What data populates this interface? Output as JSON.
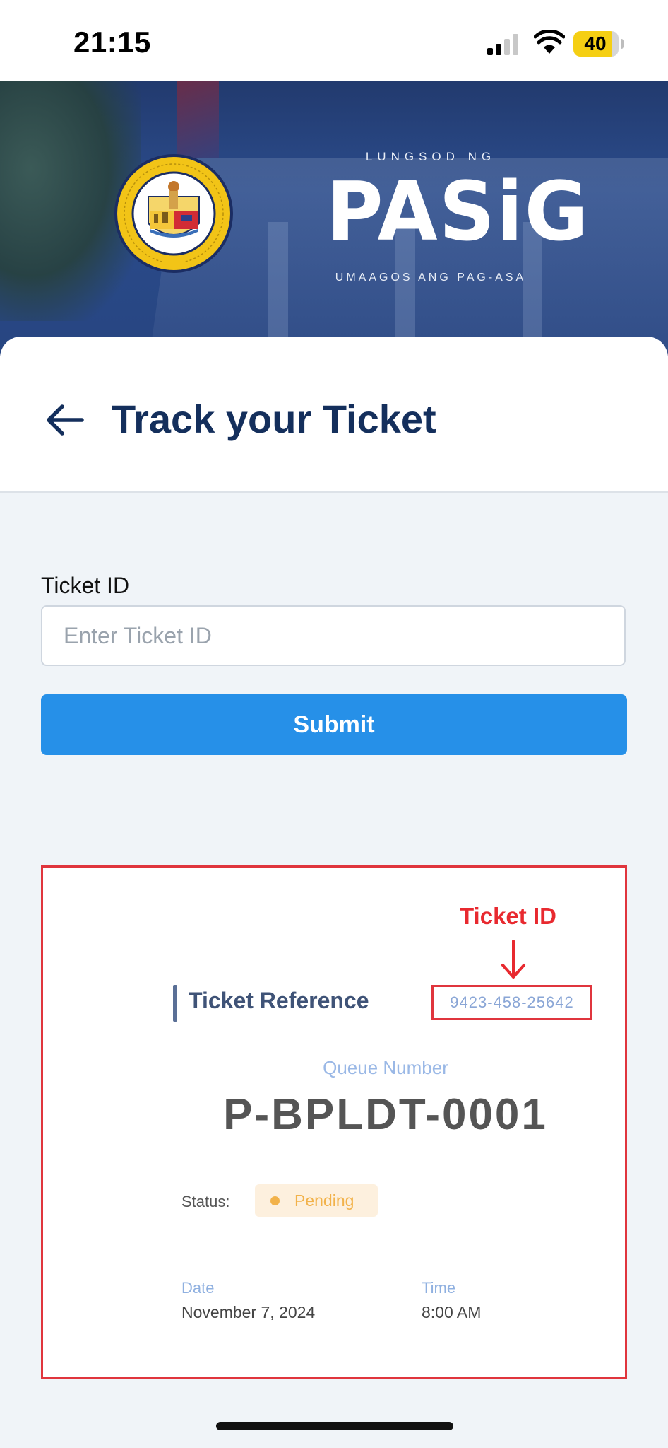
{
  "status_bar": {
    "time": "21:15",
    "battery": "40"
  },
  "banner": {
    "city_top": "LUNGSOD NG",
    "city_name": "PASiG",
    "tagline": "UMAAGOS ANG PAG-ASA"
  },
  "header": {
    "title": "Track your Ticket"
  },
  "form": {
    "label": "Ticket ID",
    "placeholder": "Enter Ticket ID",
    "value": "",
    "submit_label": "Submit"
  },
  "sample_ticket": {
    "annotation": "Ticket ID",
    "reference_label": "Ticket Reference",
    "reference_value": "9423-458-25642",
    "queue_label": "Queue Number",
    "queue_number": "P-BPLDT-0001",
    "status_label": "Status:",
    "status_value": "Pending",
    "date_label": "Date",
    "date_value": "November 7, 2024",
    "time_label": "Time",
    "time_value": "8:00 AM"
  },
  "colors": {
    "accent_blue": "#2690e8",
    "title_navy": "#142f5c",
    "annotation_red": "#e0353d",
    "pending_orange": "#f2b24a"
  }
}
